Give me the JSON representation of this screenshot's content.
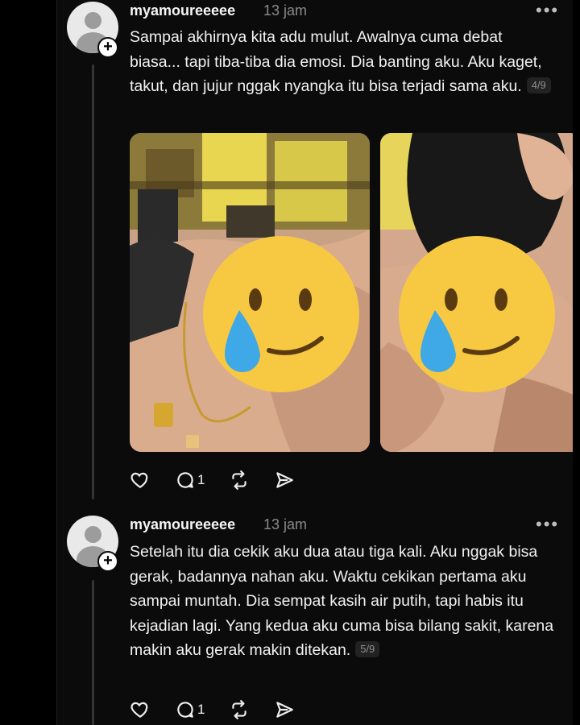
{
  "posts": [
    {
      "username": "myamoureeeee",
      "time": "13 jam",
      "more": "•••",
      "follow_symbol": "+",
      "text": "Sampai akhirnya kita adu mulut. Awalnya cuma debat biasa... tapi tiba-tiba dia emosi. Dia banting aku. Aku kaget, takut, dan jujur nggak nyangka itu bisa terjadi sama aku.",
      "counter": "4/9",
      "photos": [
        "photo-necklace",
        "photo-neck-ear"
      ],
      "actions": {
        "icons": [
          "heart-icon",
          "comment-icon",
          "repost-icon",
          "share-icon"
        ],
        "reply_count": "1"
      }
    },
    {
      "username": "myamoureeeee",
      "time": "13 jam",
      "more": "•••",
      "follow_symbol": "+",
      "text": "Setelah itu dia cekik aku dua atau tiga kali. Aku nggak bisa gerak, badannya nahan aku. Waktu cekikan pertama aku sampai muntah. Dia sempat kasih air putih, tapi habis itu kejadian lagi. Yang kedua aku cuma bisa bilang sakit, karena makin aku gerak makin ditekan.",
      "counter": "5/9",
      "actions": {
        "icons": [
          "heart-icon",
          "comment-icon",
          "repost-icon",
          "share-icon"
        ],
        "reply_count": "1"
      }
    }
  ],
  "colors": {
    "background": "#0b0b0b",
    "text": "#f1f1f1",
    "muted": "#8a8a8a",
    "thread_line": "#343434"
  }
}
